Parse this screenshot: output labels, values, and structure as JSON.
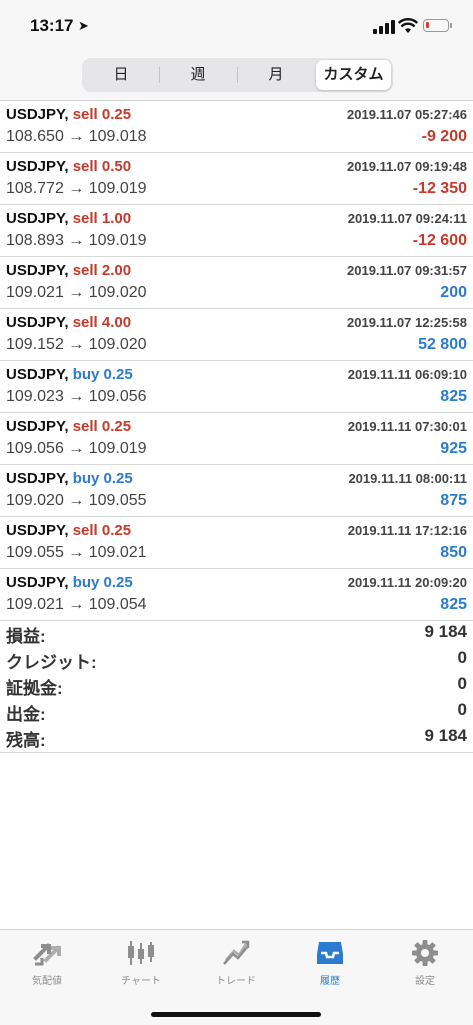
{
  "status": {
    "time": "13:17"
  },
  "period_tabs": [
    {
      "label": "日",
      "active": false
    },
    {
      "label": "週",
      "active": false
    },
    {
      "label": "月",
      "active": false
    },
    {
      "label": "カスタム",
      "active": true
    }
  ],
  "colors": {
    "sell": "#c8392b",
    "buy": "#2b7bd0",
    "accent": "#2b7bd0"
  },
  "trades": [
    {
      "symbol": "USDJPY,",
      "side": "sell",
      "side_label": "sell 0.25",
      "datetime": "2019.11.07 05:27:46",
      "prices": "108.650 → 109.018",
      "pl": "-9 200",
      "pl_type": "neg"
    },
    {
      "symbol": "USDJPY,",
      "side": "sell",
      "side_label": "sell 0.50",
      "datetime": "2019.11.07 09:19:48",
      "prices": "108.772 → 109.019",
      "pl": "-12 350",
      "pl_type": "neg"
    },
    {
      "symbol": "USDJPY,",
      "side": "sell",
      "side_label": "sell 1.00",
      "datetime": "2019.11.07 09:24:11",
      "prices": "108.893 → 109.019",
      "pl": "-12 600",
      "pl_type": "neg"
    },
    {
      "symbol": "USDJPY,",
      "side": "sell",
      "side_label": "sell 2.00",
      "datetime": "2019.11.07 09:31:57",
      "prices": "109.021 → 109.020",
      "pl": "200",
      "pl_type": "pos"
    },
    {
      "symbol": "USDJPY,",
      "side": "sell",
      "side_label": "sell 4.00",
      "datetime": "2019.11.07 12:25:58",
      "prices": "109.152 → 109.020",
      "pl": "52 800",
      "pl_type": "pos"
    },
    {
      "symbol": "USDJPY,",
      "side": "buy",
      "side_label": "buy 0.25",
      "datetime": "2019.11.11 06:09:10",
      "prices": "109.023 → 109.056",
      "pl": "825",
      "pl_type": "pos"
    },
    {
      "symbol": "USDJPY,",
      "side": "sell",
      "side_label": "sell 0.25",
      "datetime": "2019.11.11 07:30:01",
      "prices": "109.056 → 109.019",
      "pl": "925",
      "pl_type": "pos"
    },
    {
      "symbol": "USDJPY,",
      "side": "buy",
      "side_label": "buy 0.25",
      "datetime": "2019.11.11 08:00:11",
      "prices": "109.020 → 109.055",
      "pl": "875",
      "pl_type": "pos"
    },
    {
      "symbol": "USDJPY,",
      "side": "sell",
      "side_label": "sell 0.25",
      "datetime": "2019.11.11 17:12:16",
      "prices": "109.055 → 109.021",
      "pl": "850",
      "pl_type": "pos"
    },
    {
      "symbol": "USDJPY,",
      "side": "buy",
      "side_label": "buy 0.25",
      "datetime": "2019.11.11 20:09:20",
      "prices": "109.021 → 109.054",
      "pl": "825",
      "pl_type": "pos"
    }
  ],
  "summary": [
    {
      "label": "損益:",
      "value": "9 184"
    },
    {
      "label": "クレジット:",
      "value": "0"
    },
    {
      "label": "証拠金:",
      "value": "0"
    },
    {
      "label": "出金:",
      "value": "0"
    },
    {
      "label": "残高:",
      "value": "9 184"
    }
  ],
  "bottom_tabs": [
    {
      "label": "気配値",
      "icon": "quotes-arrows-icon",
      "active": false
    },
    {
      "label": "チャート",
      "icon": "candlestick-chart-icon",
      "active": false
    },
    {
      "label": "トレード",
      "icon": "trade-trend-icon",
      "active": false
    },
    {
      "label": "履歴",
      "icon": "inbox-tray-icon",
      "active": true
    },
    {
      "label": "設定",
      "icon": "gear-icon",
      "active": false
    }
  ]
}
